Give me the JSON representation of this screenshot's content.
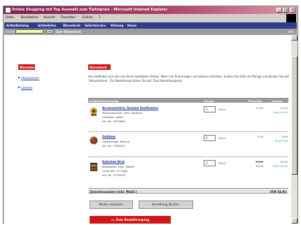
{
  "window": {
    "title": "Online Shopping mit Top Auswahl zum Tiefstpreis - Microsoft Internet Explorer",
    "controls": [
      "_",
      "□",
      "×"
    ]
  },
  "menubar": {
    "items": [
      "Datei",
      "Bearbeiten",
      "Ansicht",
      "Favoriten",
      "Extras",
      "?"
    ]
  },
  "topnav": {
    "items": [
      "Artikelkatalog",
      "Artikelinfos",
      "Warenkorb",
      "Sofortservice",
      "Sitemap",
      "Home"
    ]
  },
  "searchbar": {
    "label": "Suche",
    "value": "",
    "go_label": "Los",
    "add_link": "Zum Warenkorb",
    "help_link": "Hilfe"
  },
  "sidebar": {
    "heading": "Warenkorb",
    "links": [
      "Aktualisieren",
      "Löschen"
    ]
  },
  "main": {
    "heading": "Warenkorb",
    "intro": "Hier befinden sich alle von Ihnen bestellten Artikel. Wenn Sie Änderungen vornehmen möchten, ändern Sie bitte die Menge und klicken Sie auf 'Aktualisieren'. Zur Bestellung klicken Sie auf 'Zum Bestellvorgang'.",
    "table_headers": {
      "artikel": "Artikelbezeichnung",
      "menge": "Menge",
      "preis": "Preis/Stk.",
      "summe": "Summe"
    },
    "items": [
      {
        "title": "Accessorizers, Season Sunflowers",
        "lines": [
          "Pflanzenschale, Holz, Keramik",
          "Lieferbar: sofort",
          "Art.-Nr.: 4533650"
        ],
        "qty": "1",
        "unit": "Stück",
        "price": "14,99",
        "price2": "",
        "total": "14,99",
        "total2": "Euro 14,99"
      },
      {
        "title": "Outdoor",
        "lines": [
          "Gartenkugel, Bronze",
          "Art.-Nr.: 1409143"
        ],
        "qty": "1",
        "unit": "Stück",
        "price": "9,99",
        "price2": "",
        "total": "9,99",
        "total2": "Euro 9,99"
      },
      {
        "title": "Kuhchen Brot",
        "lines": [
          "Brotkasten, Holz, Metall",
          "Lieferzeit: 3-5 Tage",
          "Art.-Nr.: 3739159"
        ],
        "qty": "1",
        "unit": "Stück",
        "price": "39,95",
        "price2": "29,95",
        "total": "29,95",
        "total2": "Euro 29,95"
      }
    ],
    "subtotal_label": "Zwischensumme (inkl. MwSt.)",
    "subtotal_value": "EUR 54,93",
    "buttons": {
      "continue": "Weiter einkaufen",
      "delete": "Bestellung löschen",
      "order": "»» Zum Bestellvorgang"
    }
  },
  "colors": {
    "accent_red": "#d01818",
    "nav_blue": "#2e3e8c",
    "link_blue": "#1a2a99",
    "green": "#22aa22"
  }
}
